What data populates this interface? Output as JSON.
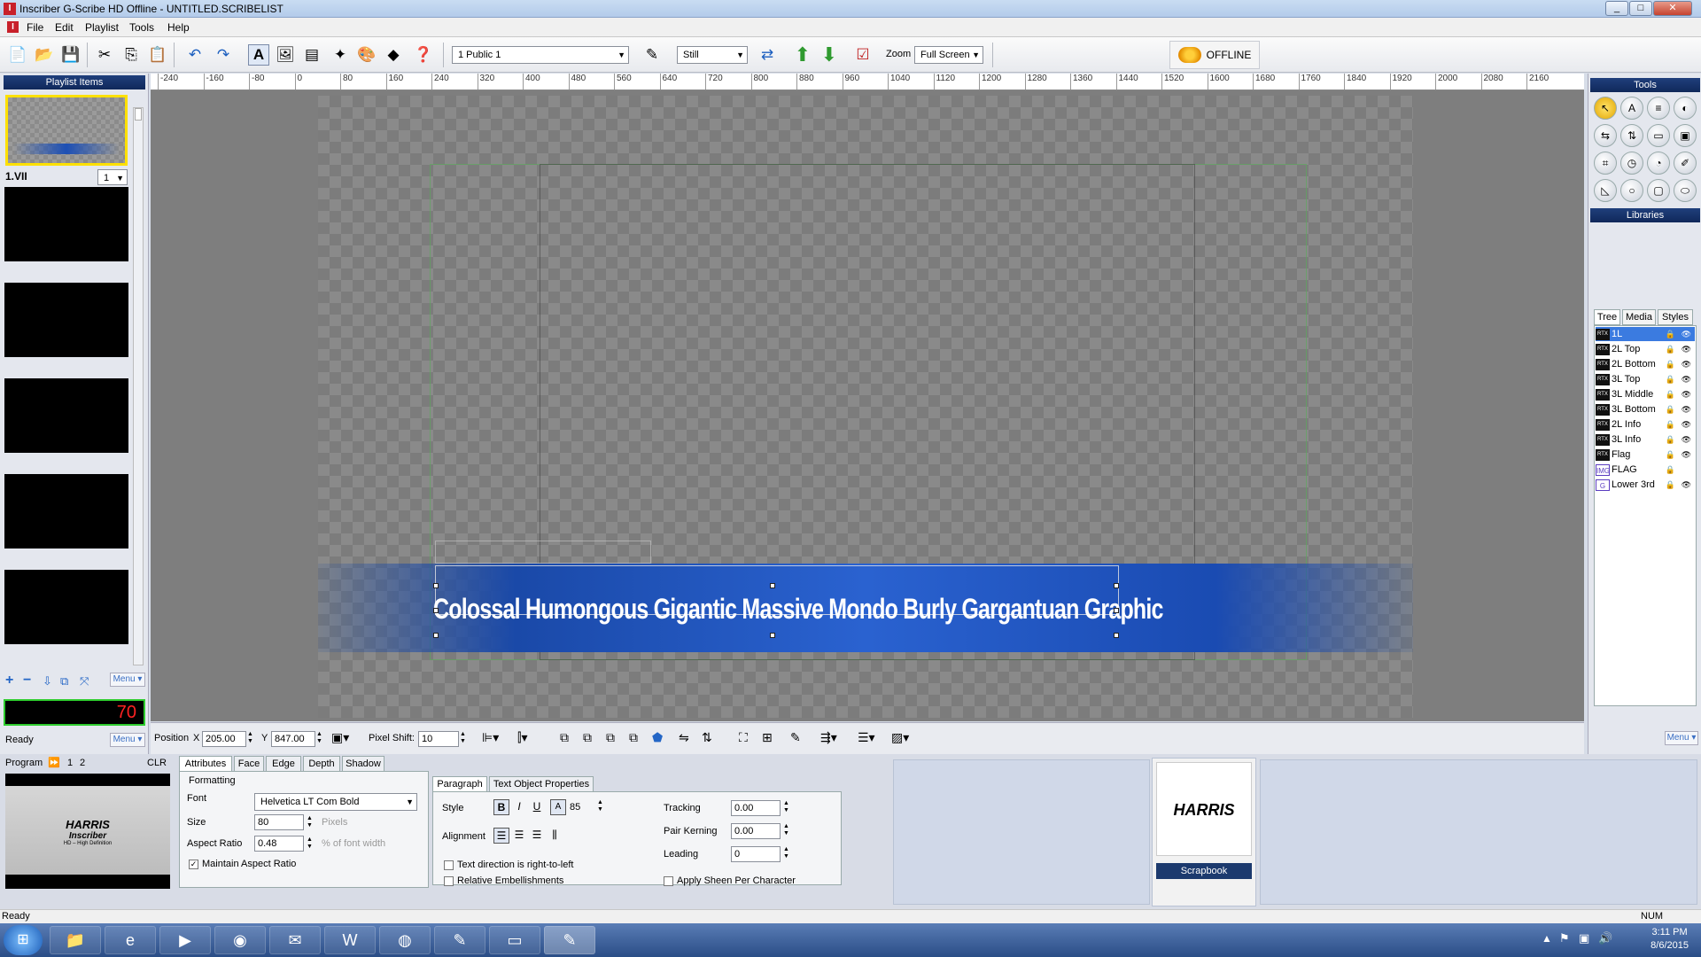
{
  "window": {
    "title": "Inscriber G-Scribe HD Offline - UNTITLED.SCRIBELIST",
    "min": "_",
    "max": "□",
    "close": "✕"
  },
  "menu": [
    "File",
    "Edit",
    "Playlist",
    "Tools",
    "Help"
  ],
  "toolbar": {
    "channel_select": "1 Public 1",
    "mode_select": "Still",
    "zoom_label": "Zoom",
    "zoom_select": "Full Screen",
    "offline_label": "OFFLINE"
  },
  "playlist": {
    "header": "Playlist Items",
    "item1_label": "1.VII",
    "item1_select": "1",
    "menu_label": "Menu ▾",
    "counter": "70",
    "status": "Ready",
    "status_menu": "Menu ▾"
  },
  "ruler": {
    "ticks": [
      "-240",
      "-160",
      "-80",
      "0",
      "80",
      "160",
      "240",
      "320",
      "400",
      "480",
      "560",
      "640",
      "720",
      "800",
      "880",
      "960",
      "1040",
      "1120",
      "1200",
      "1280",
      "1360",
      "1440",
      "1520",
      "1600",
      "1680",
      "1760",
      "1840",
      "1920",
      "2000",
      "2080",
      "2160"
    ]
  },
  "graphic_text": "Colossal Humongous Gigantic Massive Mondo Burly Gargantuan Graphic",
  "position_bar": {
    "position_label": "Position",
    "x_label": "X",
    "x_value": "205.00",
    "y_label": "Y",
    "y_value": "847.00",
    "pixel_shift_label": "Pixel Shift:",
    "pixel_shift_value": "10"
  },
  "tools_panel": {
    "header": "Tools",
    "libraries_header": "Libraries",
    "tabs": [
      "Tree",
      "Media",
      "Styles"
    ],
    "menu_label": "Menu ▾"
  },
  "libraries": [
    {
      "name": "1L",
      "type": "RTX"
    },
    {
      "name": "2L Top",
      "type": "RTX"
    },
    {
      "name": "2L Bottom",
      "type": "RTX"
    },
    {
      "name": "3L Top",
      "type": "RTX"
    },
    {
      "name": "3L Middle",
      "type": "RTX"
    },
    {
      "name": "3L Bottom",
      "type": "RTX"
    },
    {
      "name": "2L Info",
      "type": "RTX"
    },
    {
      "name": "3L Info",
      "type": "RTX"
    },
    {
      "name": "Flag",
      "type": "RTX"
    },
    {
      "name": "FLAG",
      "type": "IMG"
    },
    {
      "name": "Lower 3rd",
      "type": "G"
    }
  ],
  "program": {
    "label": "Program",
    "btn1": "1",
    "btn2": "2",
    "clr": "CLR",
    "preview_brand": "HARRIS",
    "preview_sub": "Inscriber",
    "preview_small": "HD – High Definition"
  },
  "attribute_tabs": [
    "Attributes",
    "Face",
    "Edge",
    "Depth",
    "Shadow"
  ],
  "formatting": {
    "header": "Formatting",
    "font_label": "Font",
    "font_value": "Helvetica LT Com Bold",
    "size_label": "Size",
    "size_value": "80",
    "size_unit": "Pixels",
    "aspect_label": "Aspect Ratio",
    "aspect_value": "0.48",
    "aspect_unit": "% of font width",
    "maintain_label": "Maintain Aspect Ratio"
  },
  "paragraph": {
    "tabs": [
      "Paragraph",
      "Text Object Properties"
    ],
    "style_label": "Style",
    "style_size": "85",
    "alignment_label": "Alignment",
    "rtl_label": "Text direction is right-to-left",
    "relative_label": "Relative Embellishments",
    "tracking_label": "Tracking",
    "tracking_value": "0.00",
    "kerning_label": "Pair Kerning",
    "kerning_value": "0.00",
    "leading_label": "Leading",
    "leading_value": "0",
    "sheen_label": "Apply Sheen Per Character"
  },
  "scrapbook": {
    "logo": "HARRIS",
    "label": "Scrapbook"
  },
  "statusbar": {
    "left": "Ready",
    "right": "NUM"
  },
  "taskbar": {
    "time": "3:11 PM",
    "date": "8/6/2015"
  }
}
